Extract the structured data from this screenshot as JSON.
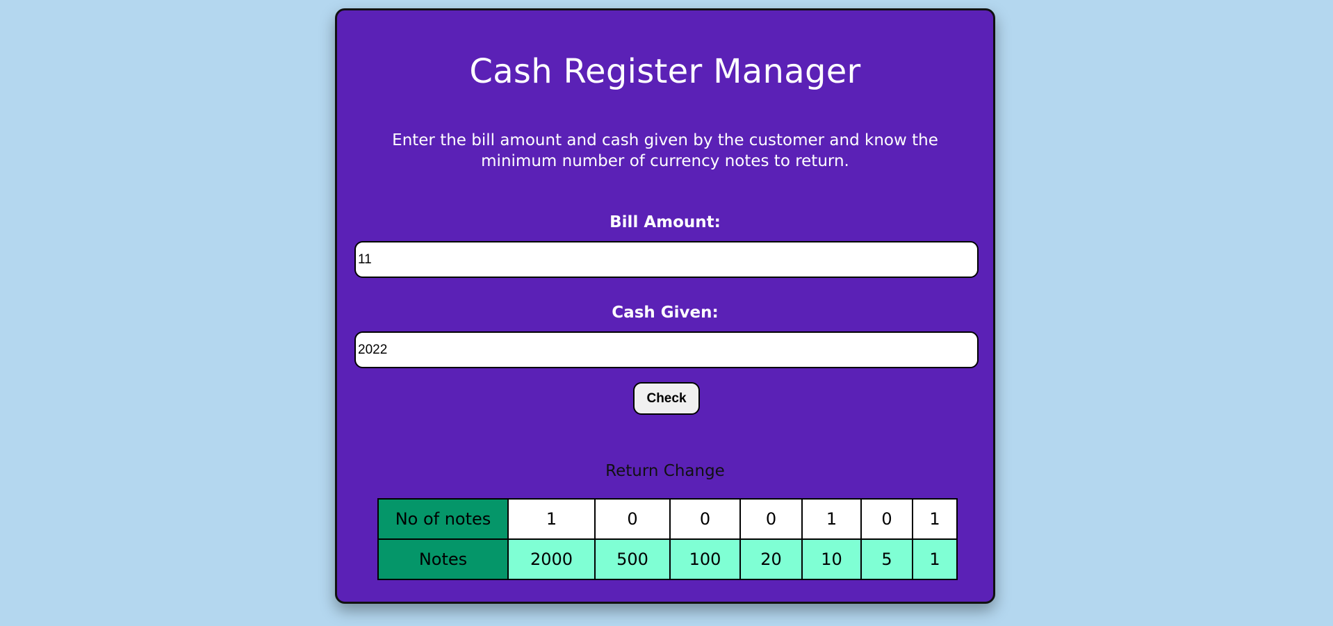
{
  "title": "Cash Register Manager",
  "description": "Enter the bill amount and cash given by the customer and know the minimum number of currency notes to return.",
  "bill_amount": {
    "label": "Bill Amount:",
    "value": "11"
  },
  "cash_given": {
    "label": "Cash Given:",
    "value": "2022"
  },
  "check_button": "Check",
  "return_change": {
    "heading": "Return Change",
    "count_row_label": "No of notes",
    "notes_row_label": "Notes",
    "counts": [
      "1",
      "0",
      "0",
      "0",
      "1",
      "0",
      "1"
    ],
    "notes": [
      "2000",
      "500",
      "100",
      "20",
      "10",
      "5",
      "1"
    ]
  },
  "colors": {
    "background": "#b4d7ef",
    "card": "#5b21b6",
    "header_cell": "#059669",
    "notes_cell": "#7fffd4"
  }
}
